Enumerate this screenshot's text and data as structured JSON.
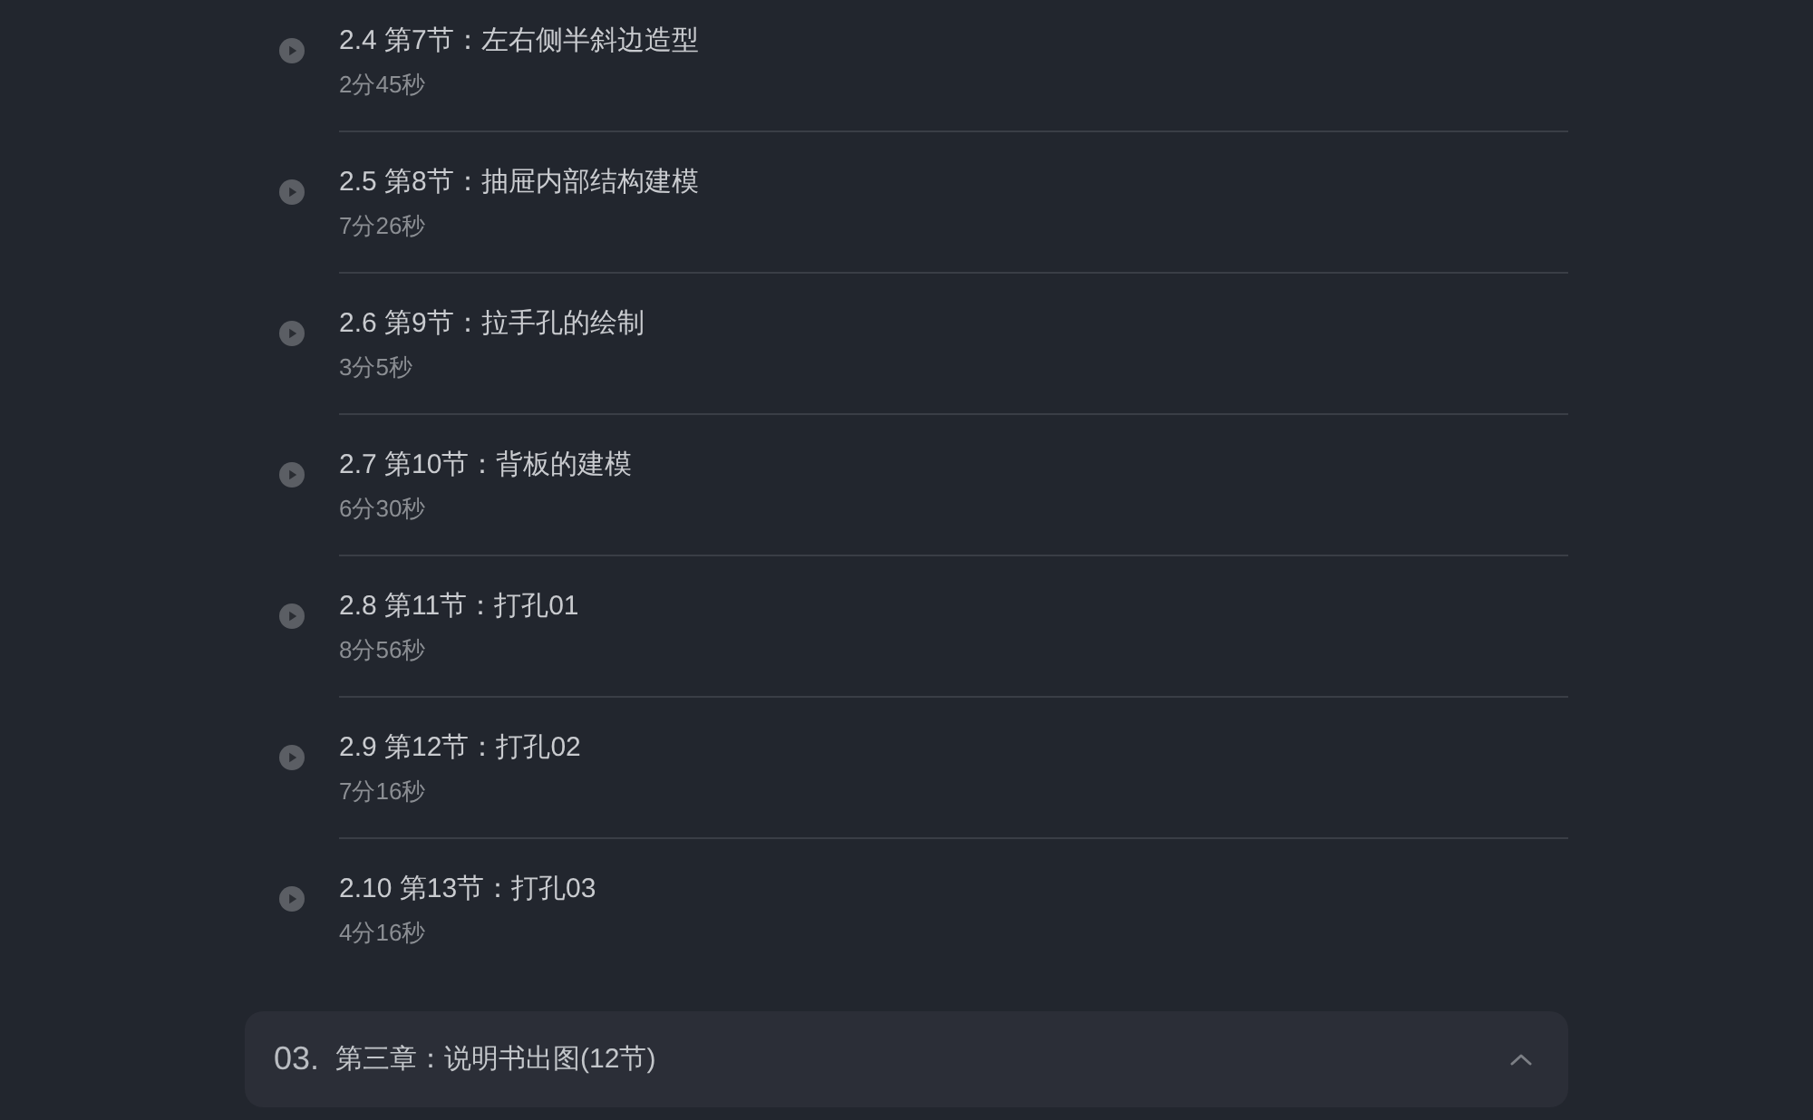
{
  "lessons": [
    {
      "title": "2.4 第7节：左右侧半斜边造型",
      "duration": "2分45秒"
    },
    {
      "title": "2.5 第8节：抽屉内部结构建模",
      "duration": "7分26秒"
    },
    {
      "title": "2.6 第9节：拉手孔的绘制",
      "duration": "3分5秒"
    },
    {
      "title": "2.7 第10节：背板的建模",
      "duration": "6分30秒"
    },
    {
      "title": "2.8 第11节：打孔01",
      "duration": "8分56秒"
    },
    {
      "title": "2.9 第12节：打孔02",
      "duration": "7分16秒"
    },
    {
      "title": "2.10 第13节：打孔03",
      "duration": "4分16秒"
    }
  ],
  "chapter": {
    "number": "03.",
    "title": "第三章：说明书出图(12节)"
  }
}
